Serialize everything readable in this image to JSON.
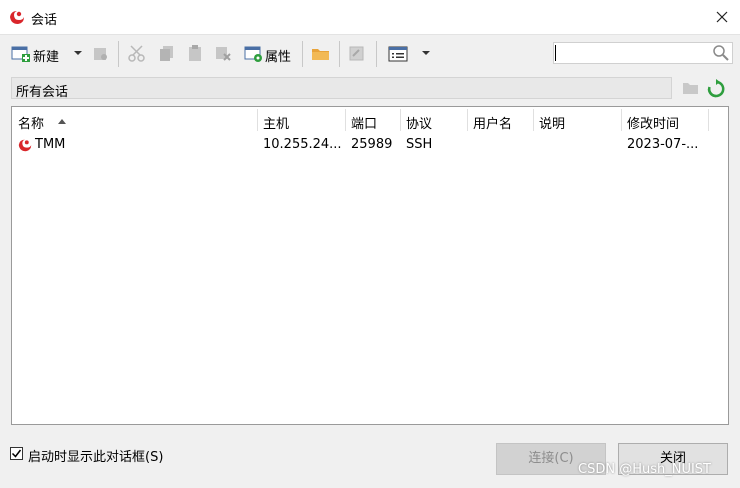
{
  "window": {
    "title": "会话",
    "close_label": "✕"
  },
  "toolbar": {
    "new_label": "新建",
    "properties_label": "属性"
  },
  "search": {
    "placeholder": "",
    "value": ""
  },
  "path": {
    "label": "所有会话"
  },
  "table": {
    "columns": [
      "名称",
      "主机",
      "端口",
      "协议",
      "用户名",
      "说明",
      "修改时间"
    ],
    "rows": [
      {
        "name": "TMM",
        "host": "10.255.24...",
        "port": "25989",
        "protocol": "SSH",
        "user": "",
        "desc": "",
        "modified": "2023-07-..."
      }
    ]
  },
  "footer": {
    "show_on_startup_label": "启动时显示此对话框(S)",
    "show_on_startup_checked": true,
    "connect_label": "连接(C)",
    "close_label": "关闭"
  },
  "watermark": "CSDN @Hush_NUIST",
  "colors": {
    "brand_red": "#d9262b",
    "refresh_green": "#2e9e3e",
    "folder": "#e8a33a"
  }
}
